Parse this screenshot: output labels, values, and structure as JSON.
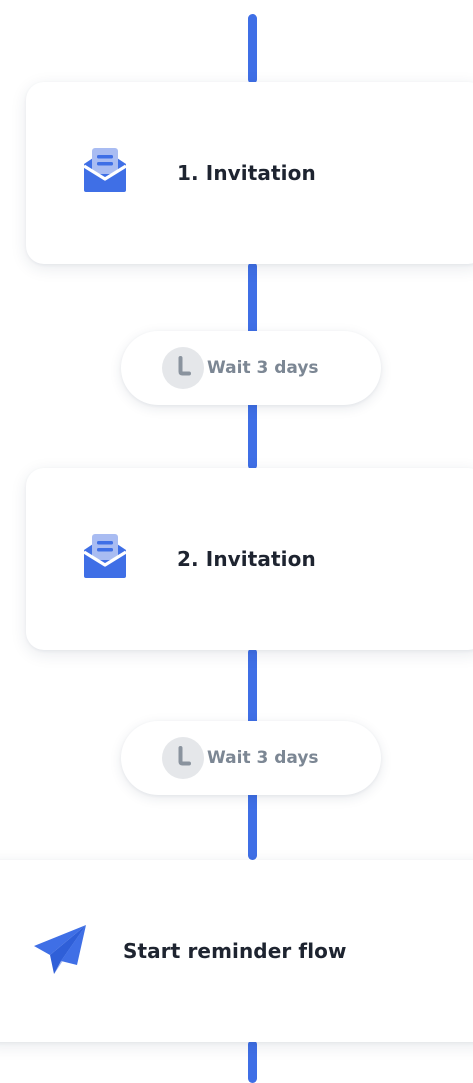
{
  "flow": {
    "steps": [
      {
        "label": "1. Invitation",
        "icon": "envelope-open-icon"
      },
      {
        "label": "2. Invitation",
        "icon": "envelope-open-icon"
      },
      {
        "label": "Start reminder flow",
        "icon": "paper-plane-icon"
      }
    ],
    "waits": [
      {
        "label": "Wait 3 days",
        "icon": "clock-icon"
      },
      {
        "label": "Wait 3 days",
        "icon": "clock-icon"
      }
    ]
  },
  "colors": {
    "accent": "#3f6fe6",
    "accent_light": "#a9bcf2",
    "title_text": "#1e2430",
    "muted_text": "#7c8794",
    "clock_bg": "#e5e7ea",
    "clock_hand": "#8a939e"
  }
}
